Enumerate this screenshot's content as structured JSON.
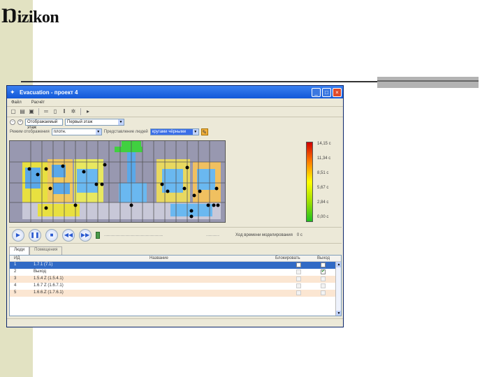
{
  "logo": {
    "text": "izikon"
  },
  "window": {
    "title": "Evacuation - проект 4",
    "menu": [
      "Файл",
      "Расчёт"
    ],
    "floor_label": "Отображаемый этаж",
    "floor_value": "Первый этаж",
    "mode_label": "Режим отображения",
    "mode_value": "плотн.",
    "people_label": "Представление людей",
    "people_value": "кругами чёрными"
  },
  "legend": {
    "labels": [
      "14,15 с",
      "11,34 с",
      "8,51 с",
      "5,67 с",
      "2,84 с",
      "0,00 с"
    ],
    "colors": [
      "#d00000",
      "#ff8000",
      "#ffff00",
      "#a0e000",
      "#20c020"
    ]
  },
  "player": {
    "status": "Ход времени моделирования",
    "time": "0 с"
  },
  "tabs": [
    "Люди",
    "Помещения"
  ],
  "table": {
    "headers": {
      "id": "ИД",
      "name": "Название",
      "blocked": "Блокировать",
      "exit": "Выход"
    },
    "rows": [
      {
        "id": "1",
        "name": "1.7.1 (7.1)",
        "blocked": false,
        "exit": false,
        "selected": true
      },
      {
        "id": "2",
        "name": "Выход",
        "blocked": false,
        "exit": true,
        "selected": false
      },
      {
        "id": "3",
        "name": "1.5.4 Z (1.5.4.1)",
        "blocked": false,
        "exit": false,
        "selected": false
      },
      {
        "id": "4",
        "name": "1.6.7 Z (1.6.7.1)",
        "blocked": false,
        "exit": false,
        "selected": false
      },
      {
        "id": "5",
        "name": "1.6.6.Z (1.7.6.1)",
        "blocked": false,
        "exit": false,
        "selected": false
      }
    ]
  }
}
